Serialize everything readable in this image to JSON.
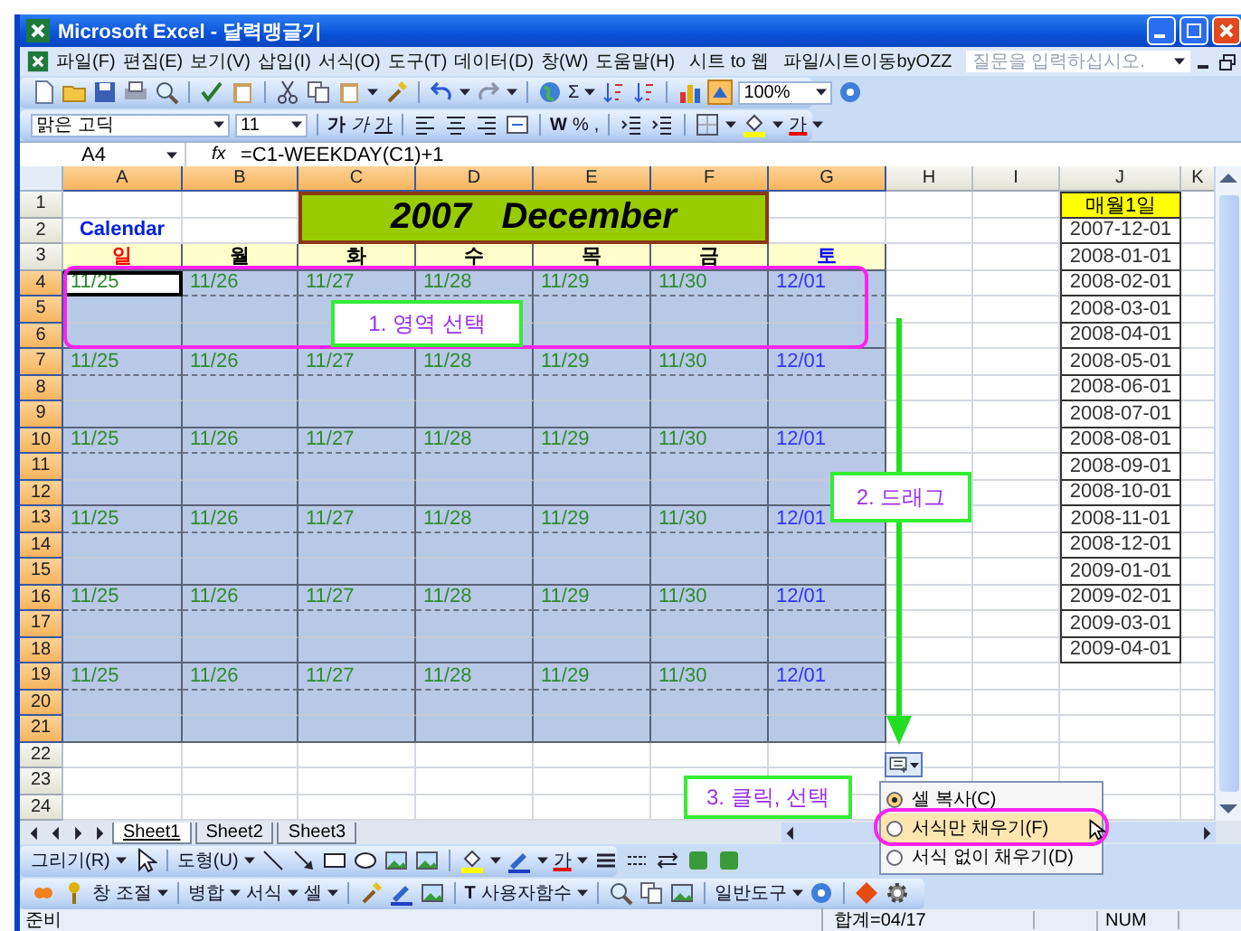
{
  "window": {
    "title": "Microsoft Excel - 달력맹글기"
  },
  "menu_bar": {
    "items": [
      {
        "label": "파일(F)"
      },
      {
        "label": "편집(E)"
      },
      {
        "label": "보기(V)"
      },
      {
        "label": "삽입(I)"
      },
      {
        "label": "서식(O)"
      },
      {
        "label": "도구(T)"
      },
      {
        "label": "데이터(D)"
      },
      {
        "label": "창(W)"
      },
      {
        "label": "도움말(H)"
      },
      {
        "label": "시트 to 웹"
      },
      {
        "label": "파일/시트이동byOZZ"
      }
    ],
    "help_placeholder": "질문을 입력하십시오."
  },
  "standard_toolbar": {
    "labels": [
      "Σ"
    ],
    "zoom": "100%"
  },
  "formatting_toolbar": {
    "font": "맑은 고딕",
    "size": "11",
    "labels": [
      "가",
      "가",
      "가",
      "W",
      "%",
      ",",
      "가"
    ]
  },
  "formula_bar": {
    "name_box": "A4",
    "fx": "fx",
    "formula": "=C1-WEEKDAY(C1)+1"
  },
  "sheet": {
    "columns": [
      {
        "label": "A",
        "highlighted": true
      },
      {
        "label": "B",
        "highlighted": true
      },
      {
        "label": "C",
        "highlighted": true
      },
      {
        "label": "D",
        "highlighted": true
      },
      {
        "label": "E",
        "highlighted": true
      },
      {
        "label": "F",
        "highlighted": true
      },
      {
        "label": "G",
        "highlighted": true
      },
      {
        "label": "H",
        "highlighted": false
      },
      {
        "label": "I",
        "highlighted": false
      },
      {
        "label": "J",
        "highlighted": false
      },
      {
        "label": "K",
        "highlighted": false
      }
    ],
    "rows": [
      {
        "label": "1",
        "highlighted": false
      },
      {
        "label": "2",
        "highlighted": false
      },
      {
        "label": "3",
        "highlighted": false
      },
      {
        "label": "4",
        "highlighted": true
      },
      {
        "label": "5",
        "highlighted": true
      },
      {
        "label": "6",
        "highlighted": true
      },
      {
        "label": "7",
        "highlighted": true
      },
      {
        "label": "8",
        "highlighted": true
      },
      {
        "label": "9",
        "highlighted": true
      },
      {
        "label": "10",
        "highlighted": true
      },
      {
        "label": "11",
        "highlighted": true
      },
      {
        "label": "12",
        "highlighted": true
      },
      {
        "label": "13",
        "highlighted": true
      },
      {
        "label": "14",
        "highlighted": true
      },
      {
        "label": "15",
        "highlighted": true
      },
      {
        "label": "16",
        "highlighted": true
      },
      {
        "label": "17",
        "highlighted": true
      },
      {
        "label": "18",
        "highlighted": true
      },
      {
        "label": "19",
        "highlighted": true
      },
      {
        "label": "20",
        "highlighted": true
      },
      {
        "label": "21",
        "highlighted": true
      },
      {
        "label": "22",
        "highlighted": false
      },
      {
        "label": "23",
        "highlighted": false
      },
      {
        "label": "24",
        "highlighted": false
      }
    ],
    "title": "2007   December",
    "caption": "Calendar",
    "weekdays": [
      {
        "label": "일",
        "color": "#ff0000"
      },
      {
        "label": "월",
        "color": "#000000"
      },
      {
        "label": "화",
        "color": "#000000"
      },
      {
        "label": "수",
        "color": "#000000"
      },
      {
        "label": "목",
        "color": "#000000"
      },
      {
        "label": "금",
        "color": "#000000"
      },
      {
        "label": "토",
        "color": "#0000ff"
      }
    ],
    "date_columns": [
      {
        "color": "#2e8b2e"
      },
      {
        "color": "#2e8b2e"
      },
      {
        "color": "#2e8b2e"
      },
      {
        "color": "#2e8b2e"
      },
      {
        "color": "#2e8b2e"
      },
      {
        "color": "#2e8b2e"
      },
      {
        "color": "#3333ff"
      }
    ],
    "weeks": [
      {
        "dates": [
          "11/25",
          "11/26",
          "11/27",
          "11/28",
          "11/29",
          "11/30",
          "12/01"
        ],
        "selected": true,
        "active": true
      },
      {
        "dates": [
          "11/25",
          "11/26",
          "11/27",
          "11/28",
          "11/29",
          "11/30",
          "12/01"
        ],
        "selected": true,
        "active": false
      },
      {
        "dates": [
          "11/25",
          "11/26",
          "11/27",
          "11/28",
          "11/29",
          "11/30",
          "12/01"
        ],
        "selected": true,
        "active": false
      },
      {
        "dates": [
          "11/25",
          "11/26",
          "11/27",
          "11/28",
          "11/29",
          "11/30",
          "12/01"
        ],
        "selected": true,
        "active": false
      },
      {
        "dates": [
          "11/25",
          "11/26",
          "11/27",
          "11/28",
          "11/29",
          "11/30",
          "12/01"
        ],
        "selected": true,
        "active": false
      },
      {
        "dates": [
          "11/25",
          "11/26",
          "11/27",
          "11/28",
          "11/29",
          "11/30",
          "12/01"
        ],
        "selected": true,
        "active": false
      }
    ],
    "monthly_header": "매월1일",
    "monthly_dates": [
      "2007-12-01",
      "2008-01-01",
      "2008-02-01",
      "2008-03-01",
      "2008-04-01",
      "2008-05-01",
      "2008-06-01",
      "2008-07-01",
      "2008-08-01",
      "2008-09-01",
      "2008-10-01",
      "2008-11-01",
      "2008-12-01",
      "2009-01-01",
      "2009-02-01",
      "2009-03-01",
      "2009-04-01"
    ]
  },
  "callouts": [
    {
      "text": "1. 영역 선택"
    },
    {
      "text": "2. 드래그"
    },
    {
      "text": "3. 클릭, 선택"
    }
  ],
  "autofill_menu": {
    "items": [
      {
        "label": "셀 복사(C)",
        "selected": true,
        "hovered": false
      },
      {
        "label": "서식만 채우기(F)",
        "selected": false,
        "hovered": true
      },
      {
        "label": "서식 없이 채우기(D)",
        "selected": false,
        "hovered": false
      }
    ]
  },
  "sheet_tabs": [
    {
      "label": "Sheet1",
      "selected": true
    },
    {
      "label": "Sheet2",
      "selected": false
    },
    {
      "label": "Sheet3",
      "selected": false
    }
  ],
  "drawing_toolbar": {
    "labels": [
      "그리기(R)",
      "도형(U)",
      "가"
    ]
  },
  "custom_toolbar": {
    "labels": [
      "창 조절",
      "병합",
      "서식",
      "셀",
      "T",
      "사용자함수",
      "일반도구"
    ]
  },
  "status_bar": {
    "state": "준비",
    "sum": "합계=04/17",
    "num_lock": "NUM"
  }
}
